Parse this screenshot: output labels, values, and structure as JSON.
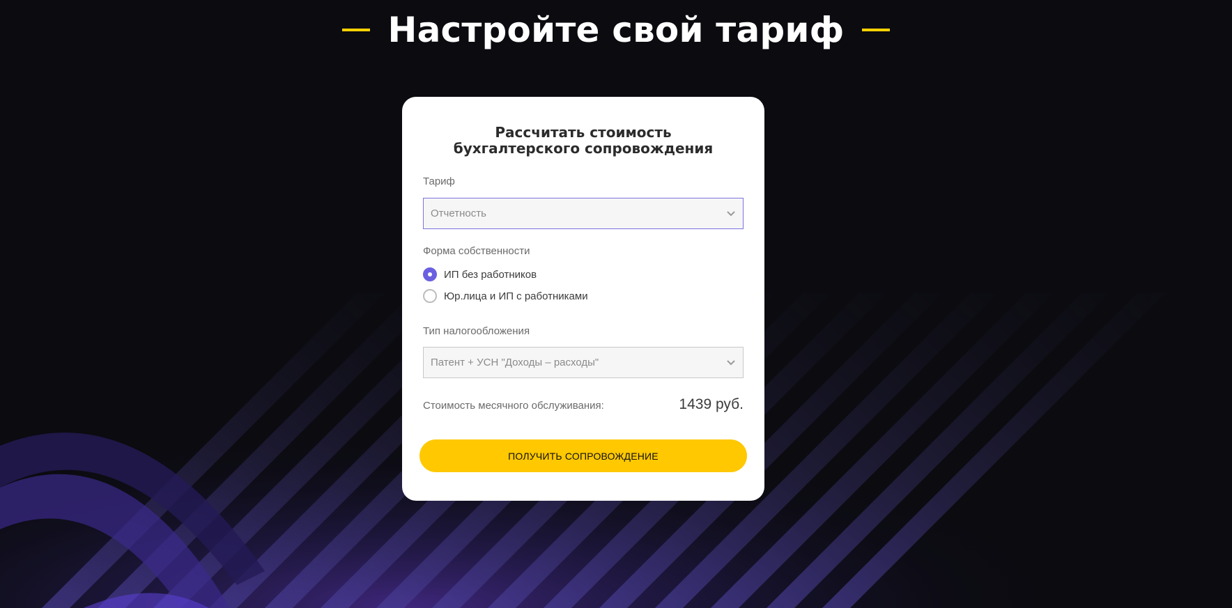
{
  "page": {
    "heading": "Настройте свой тариф",
    "accent_color": "#ffd200"
  },
  "calculator": {
    "title_line1": "Рассчитать стоимость",
    "title_line2": "бухгалтерского сопровождения",
    "tariff": {
      "label": "Тариф",
      "value": "Отчетность"
    },
    "ownership": {
      "label": "Форма собственности",
      "options": [
        {
          "label": "ИП без работников",
          "checked": true
        },
        {
          "label": "Юр.лица и ИП с работниками",
          "checked": false
        }
      ]
    },
    "taxation": {
      "label": "Тип налогообложения",
      "value": "Патент + УСН \"Доходы – расходы\""
    },
    "cost": {
      "label": "Стоимость месячного обслуживания:",
      "value": "1439 руб."
    },
    "cta_label": "ПОЛУЧИТЬ СОПРОВОЖДЕНИЕ",
    "radio_color": "#6a60e0",
    "button_color": "#ffc800"
  }
}
